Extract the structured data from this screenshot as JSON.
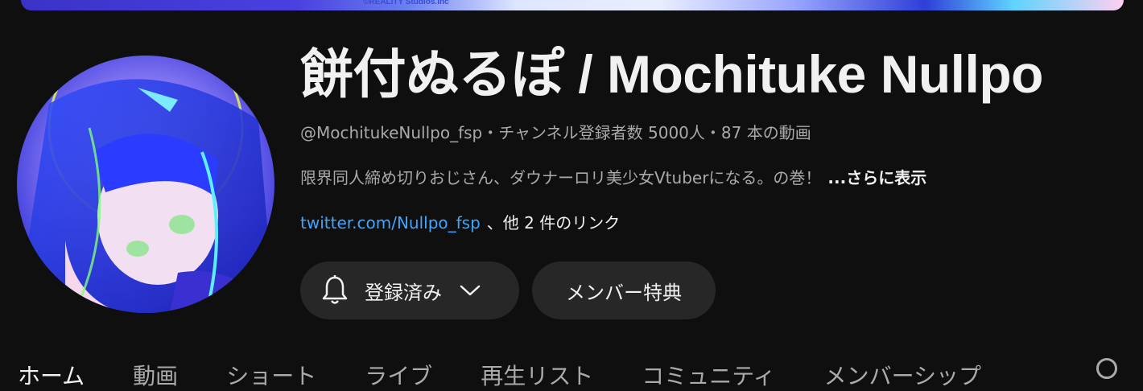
{
  "banner": {
    "credit": "©REALITY Studios.inc"
  },
  "channel": {
    "name": "餅付ぬるぽ / Mochituke Nullpo",
    "handle": "@MochitukeNullpo_fsp",
    "separator": "・",
    "subscribers": "チャンネル登録者数 5000人",
    "videos": "87 本の動画",
    "description": "限界同人締め切りおじさん、ダウナーロリ美少女Vtuberになる。の巻！",
    "more_label": "...さらに表示",
    "link_text": "twitter.com/Nullpo_fsp",
    "more_links": "、他 2 件のリンク"
  },
  "buttons": {
    "subscribed_label": "登録済み",
    "membership_label": "メンバー特典"
  },
  "tabs": [
    "ホーム",
    "動画",
    "ショート",
    "ライブ",
    "再生リスト",
    "コミュニティ",
    "メンバーシップ"
  ],
  "icons": [
    "bell-icon",
    "chevron-down-icon",
    "search-icon"
  ],
  "colors": {
    "background": "#0f0f0f",
    "button": "#272727",
    "link": "#3ea6ff",
    "secondary_text": "#aaaaaa"
  }
}
